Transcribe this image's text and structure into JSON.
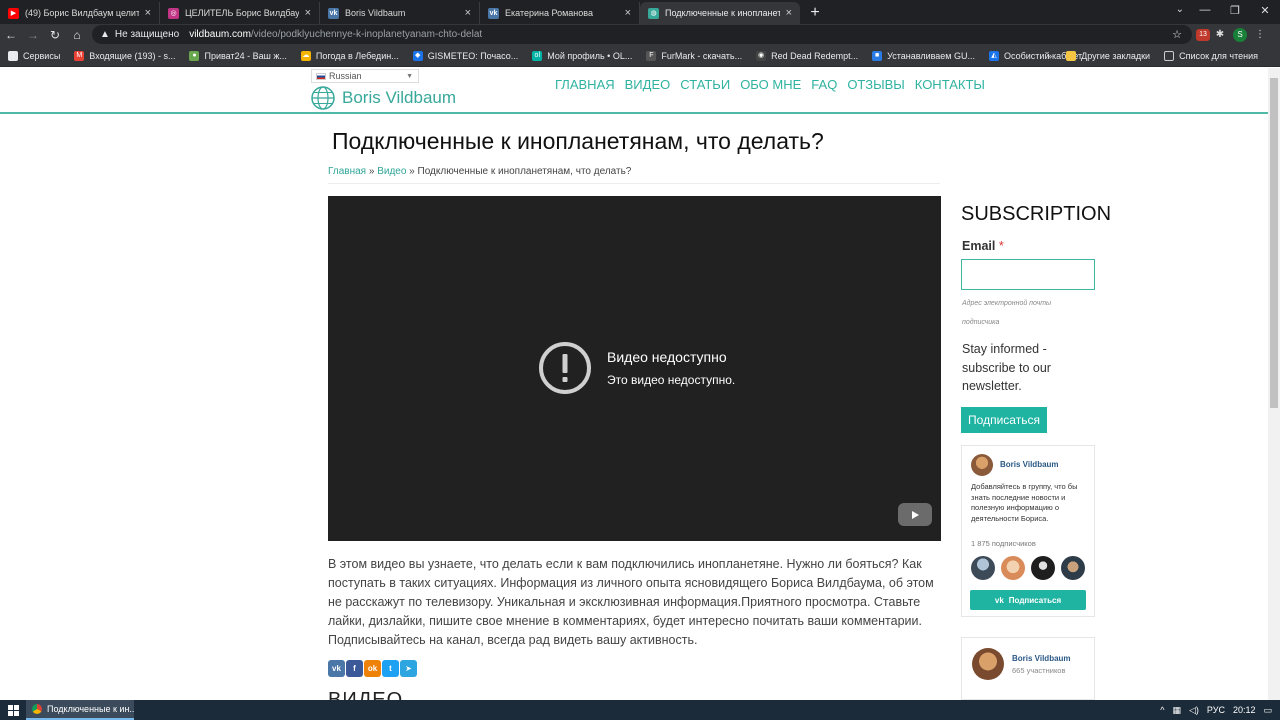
{
  "browser": {
    "tabs": [
      {
        "title": "(49) Борис Вилдбаум целитель ...",
        "fav_color": "#ff0000",
        "fav_glyph": "▶",
        "active": false
      },
      {
        "title": "ЦЕЛИТЕЛЬ Борис Вилдбаум (@...",
        "fav_color": "#c13584",
        "fav_glyph": "◎",
        "active": false
      },
      {
        "title": "Boris Vildbaum",
        "fav_color": "#4a76a8",
        "fav_glyph": "vk",
        "active": false
      },
      {
        "title": "Екатерина Романова",
        "fav_color": "#4a76a8",
        "fav_glyph": "vk",
        "active": false
      },
      {
        "title": "Подключенные к инопланетянам...",
        "fav_color": "#37a89a",
        "fav_glyph": "◍",
        "active": true
      }
    ],
    "new_tab": "+",
    "address": {
      "security_text": "Не защищено",
      "domain": "vildbaum.com",
      "path": "/video/podklyuchennye-k-inoplanetyanam-chto-delat"
    },
    "ext_badge": "13",
    "profile_initial": "S",
    "bookmarks": [
      {
        "label": "Сервисы",
        "color": "#e8eaed",
        "glyph": "⋮"
      },
      {
        "label": "Входящие (193) - s...",
        "color": "#ea4335",
        "glyph": "M"
      },
      {
        "label": "Приват24 - Ваш ж...",
        "color": "#6aa84f",
        "glyph": "●"
      },
      {
        "label": "Погода в Лебедин...",
        "color": "#f4b400",
        "glyph": "☁"
      },
      {
        "label": "GISMETEO: Почасо...",
        "color": "#1a73e8",
        "glyph": "◆"
      },
      {
        "label": "Мой профиль • OL...",
        "color": "#00b3a6",
        "glyph": "ol"
      },
      {
        "label": "FurMark - скачать...",
        "color": "#555",
        "glyph": "F"
      },
      {
        "label": "Red Dead Redempt...",
        "color": "#444",
        "glyph": "◉"
      },
      {
        "label": "Устанавливаем GU...",
        "color": "#2c7be5",
        "glyph": "■"
      },
      {
        "label": "Особистий кабінет",
        "color": "#1a73e8",
        "glyph": "◭"
      }
    ],
    "bookmarks_more": "»",
    "other_bookmarks": "Другие закладки",
    "reading_list": "Список для чтения"
  },
  "site": {
    "language": "Russian",
    "brand": "Boris Vildbaum",
    "nav": [
      "ГЛАВНАЯ",
      "ВИДЕО",
      "СТАТЬИ",
      "ОБО МНЕ",
      "FAQ",
      "ОТЗЫВЫ",
      "КОНТАКТЫ"
    ],
    "accent_color": "#1fb3a2"
  },
  "page": {
    "title": "Подключенные к инопланетянам, что делать?",
    "breadcrumb": {
      "home": "Главная",
      "sep1": " » ",
      "section": "Видео",
      "sep2": " » ",
      "current": "Подключенные к инопланетянам, что делать?"
    },
    "video": {
      "error_title": "Видео недоступно",
      "error_text": "Это видео недоступно."
    },
    "description": "В этом видео вы узнаете, что делать если к вам подключились инопланетяне. Нужно ли бояться? Как поступать в таких ситуациях. Информация из личного опыта ясновидящего Бориса Вилдбаума, об этом не расскажут по телевизору. Уникальная и эксклюзивная информация.Приятного просмотра. Ставьте лайки, дизлайки, пишите свое мнение в комментариях, будет интересно почитать ваши комментарии. Подписывайтесь на канал, всегда рад видеть вашу активность.",
    "share_buttons": [
      {
        "name": "vk",
        "glyph": "vk",
        "color": "#4a76a8"
      },
      {
        "name": "facebook",
        "glyph": "f",
        "color": "#3b5998"
      },
      {
        "name": "odnoklassniki",
        "glyph": "ok",
        "color": "#ee8208"
      },
      {
        "name": "twitter",
        "glyph": "t",
        "color": "#1da1f2"
      },
      {
        "name": "telegram",
        "glyph": "➤",
        "color": "#2ca5e0"
      }
    ],
    "next_heading": "ВИДЕО"
  },
  "sidebar": {
    "subscription_title": "SUBSCRIPTION",
    "email_label": "Email",
    "required_mark": "*",
    "email_hint": "Адрес электронной почты подписчика",
    "stay_informed": "Stay informed - subscribe to our newsletter.",
    "subscribe_button": "Подписаться",
    "vk_widget": {
      "name": "Boris Vildbaum",
      "text": "Добавляйтесь в группу, что бы знать последние новости и полезную информацию о деятельности Бориса.",
      "followers": "1 875 подписчиков",
      "button": "Подписаться",
      "button_glyph": "vk"
    },
    "vk_widget2": {
      "name": "Boris Vildbaum",
      "members": "665 участников"
    }
  },
  "taskbar": {
    "app_title": "Подключенные к ин...",
    "lang": "РУС",
    "time": "20:12"
  }
}
